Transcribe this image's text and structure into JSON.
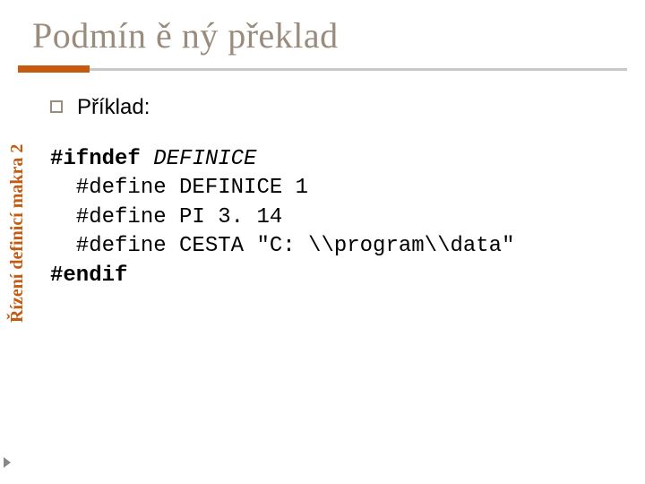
{
  "title": "Podmín ě ný překlad",
  "bullet": "Příklad:",
  "side_label": "Řízení definicí makra 2",
  "code": {
    "line1_kw": "#ifndef",
    "line1_id": " DEFINICE",
    "line2": "  #define DEFINICE 1",
    "line3": "  #define PI 3. 14",
    "line4": "  #define CESTA \"C: \\\\program\\\\data\"",
    "line5_kw": "#endif"
  }
}
